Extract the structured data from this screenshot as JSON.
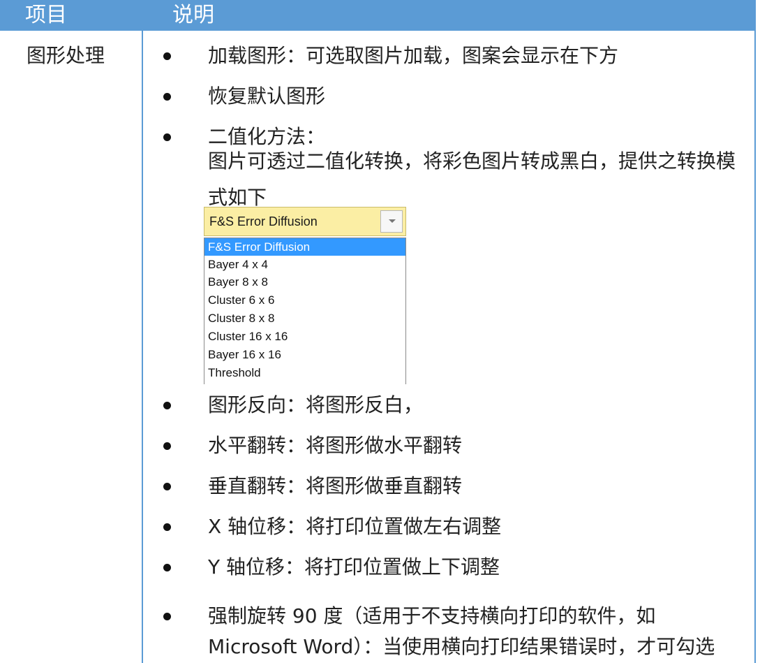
{
  "header": {
    "col1": "项目",
    "col2": "说明"
  },
  "row": {
    "item": "图形处理",
    "bullets": [
      "加载图形：可选取图片加载，图案会显示在下方",
      "恢复默认图形",
      "二值化方法：",
      "图形反向：将图形反白，",
      "水平翻转：将图形做水平翻转",
      "垂直翻转：将图形做垂直翻转",
      "X 轴位移：将打印位置做左右调整",
      "Y 轴位移：将打印位置做上下调整",
      "强制旋转 90 度（适用于不支持横向打印的软件，如 Microsoft Word）：当使用横向打印结果错误时，才可勾选"
    ],
    "binarize_desc": "图片可透过二值化转换，将彩色图片转成黑白，提供之转换模式如下"
  },
  "dropdown": {
    "selected": "F&S Error Diffusion",
    "options": [
      "F&S Error Diffusion",
      "Bayer 4 x 4",
      "Bayer 8 x 8",
      "Cluster 6 x 6",
      "Cluster 8 x 8",
      "Cluster 16 x 16",
      "Bayer 16 x 16",
      "Threshold"
    ],
    "highlighted_index": 0
  },
  "colors": {
    "header_bg": "#5b9bd5",
    "combo_bg": "#fbeea4",
    "selection": "#3399ff"
  }
}
